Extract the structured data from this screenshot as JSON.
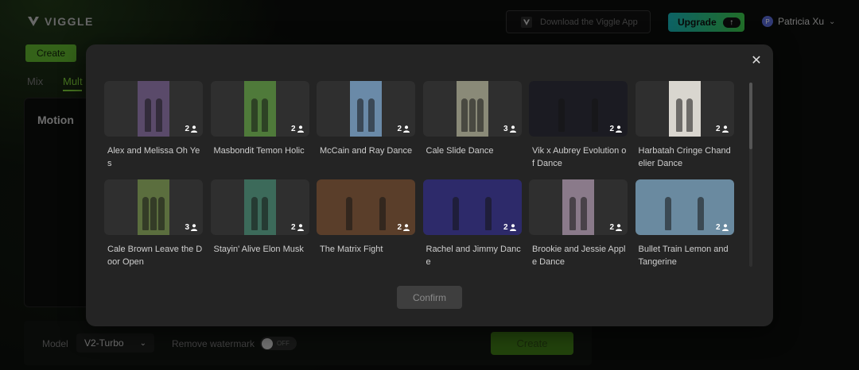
{
  "header": {
    "logo_text": "VIGGLE",
    "download_label": "Download the Viggle App",
    "upgrade_label": "Upgrade",
    "user_initial": "P",
    "user_name": "Patricia Xu"
  },
  "page": {
    "create_chip": "Create",
    "tabs": [
      {
        "label": "Mix"
      },
      {
        "label": "Mult"
      }
    ],
    "motion_label": "Motion",
    "model_label": "Model",
    "model_value": "V2-Turbo",
    "watermark_label": "Remove watermark",
    "toggle_text": "OFF",
    "create_button": "Create"
  },
  "modal": {
    "confirm_label": "Confirm",
    "templates": [
      {
        "title": "Alex and Melissa Oh Yes",
        "count": "2",
        "bg": "#5a4a6a"
      },
      {
        "title": "Masbondit Temon Holic",
        "count": "2",
        "bg": "#4f7a3a"
      },
      {
        "title": "McCain and Ray Dance",
        "count": "2",
        "bg": "#6a8aa8"
      },
      {
        "title": "Cale Slide Dance",
        "count": "3",
        "bg": "#8a8a78"
      },
      {
        "title": "Vik x Aubrey Evolution of Dance",
        "count": "2",
        "bg": "#1b1b22"
      },
      {
        "title": "Harbatah Cringe Chandelier Dance",
        "count": "2",
        "bg": "#d9d6cf"
      },
      {
        "title": "Cale Brown Leave the Door Open",
        "count": "3",
        "bg": "#5b6e3e"
      },
      {
        "title": "Stayin' Alive Elon Musk",
        "count": "2",
        "bg": "#3c6a5a"
      },
      {
        "title": "The Matrix Fight",
        "count": "2",
        "bg": "#5a3e2a"
      },
      {
        "title": "Rachel and Jimmy Dance",
        "count": "2",
        "bg": "#2d2a6a"
      },
      {
        "title": "Brookie and Jessie Apple Dance",
        "count": "2",
        "bg": "#8a7a8a"
      },
      {
        "title": "Bullet Train Lemon and Tangerine",
        "count": "2",
        "bg": "#6a8aa0"
      }
    ]
  }
}
